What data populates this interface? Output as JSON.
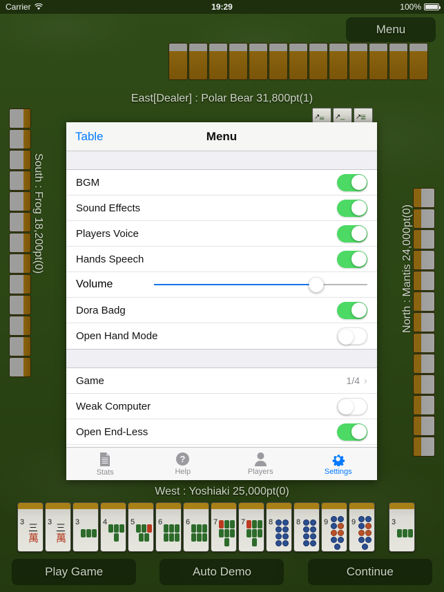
{
  "status_bar": {
    "carrier": "Carrier",
    "wifi_icon": "wifi-icon",
    "time": "19:29",
    "battery_percent": "100%",
    "battery_icon": "battery-full-icon"
  },
  "game": {
    "menu_button": "Menu",
    "players": {
      "east": "East[Dealer] : Polar Bear 31,800pt(1)",
      "south": "South : Frog 18,200pt(0)",
      "north": "North : Mantis 24,000pt(0)",
      "west": "West : Yoshiaki 25,000pt(0)"
    },
    "wall_top_tiles": 13,
    "wall_left_tiles": 13,
    "wall_right_tiles": 13,
    "discards": [
      "2s",
      "1s",
      "5s"
    ],
    "hand": [
      {
        "num": "3",
        "suit": "characters",
        "glyph": "三萬"
      },
      {
        "num": "3",
        "suit": "characters",
        "glyph": "三萬"
      },
      {
        "num": "3",
        "suit": "bamboo"
      },
      {
        "num": "4",
        "suit": "bamboo"
      },
      {
        "num": "5",
        "suit": "bamboo",
        "red": true
      },
      {
        "num": "6",
        "suit": "bamboo"
      },
      {
        "num": "6",
        "suit": "bamboo"
      },
      {
        "num": "7",
        "suit": "bamboo"
      },
      {
        "num": "7",
        "suit": "bamboo"
      },
      {
        "num": "8",
        "suit": "dots"
      },
      {
        "num": "8",
        "suit": "dots"
      },
      {
        "num": "9",
        "suit": "dots"
      },
      {
        "num": "9",
        "suit": "dots"
      }
    ],
    "drawn_tile": {
      "num": "3",
      "suit": "bamboo"
    },
    "actions": [
      "Play Game",
      "Auto Demo",
      "Continue"
    ]
  },
  "modal": {
    "back_label": "Table",
    "title": "Menu",
    "sections": [
      {
        "rows": [
          {
            "label": "BGM",
            "type": "switch",
            "on": true
          },
          {
            "label": "Sound Effects",
            "type": "switch",
            "on": true
          },
          {
            "label": "Players Voice",
            "type": "switch",
            "on": true
          },
          {
            "label": "Hands Speech",
            "type": "switch",
            "on": true
          },
          {
            "label": "Volume",
            "type": "slider",
            "percent": 76
          },
          {
            "label": "Dora Badg",
            "type": "switch",
            "on": true
          },
          {
            "label": "Open Hand Mode",
            "type": "switch",
            "on": false
          }
        ]
      },
      {
        "rows": [
          {
            "label": "Game",
            "type": "disclosure",
            "value": "1/4"
          },
          {
            "label": "Weak Computer",
            "type": "switch",
            "on": false
          },
          {
            "label": "Open End-Less",
            "type": "switch",
            "on": true
          },
          {
            "label": "",
            "type": "switch",
            "on": true
          }
        ]
      }
    ],
    "tabs": [
      {
        "label": "Stats",
        "icon": "document-icon",
        "active": false
      },
      {
        "label": "Help",
        "icon": "question-circle-icon",
        "active": false
      },
      {
        "label": "Players",
        "icon": "person-icon",
        "active": false
      },
      {
        "label": "Settings",
        "icon": "gear-icon",
        "active": true
      }
    ]
  },
  "colors": {
    "accent_blue": "#007aff",
    "switch_green": "#4cd964",
    "slider_blue": "#1572e8",
    "table_green": "#2e4a16"
  }
}
